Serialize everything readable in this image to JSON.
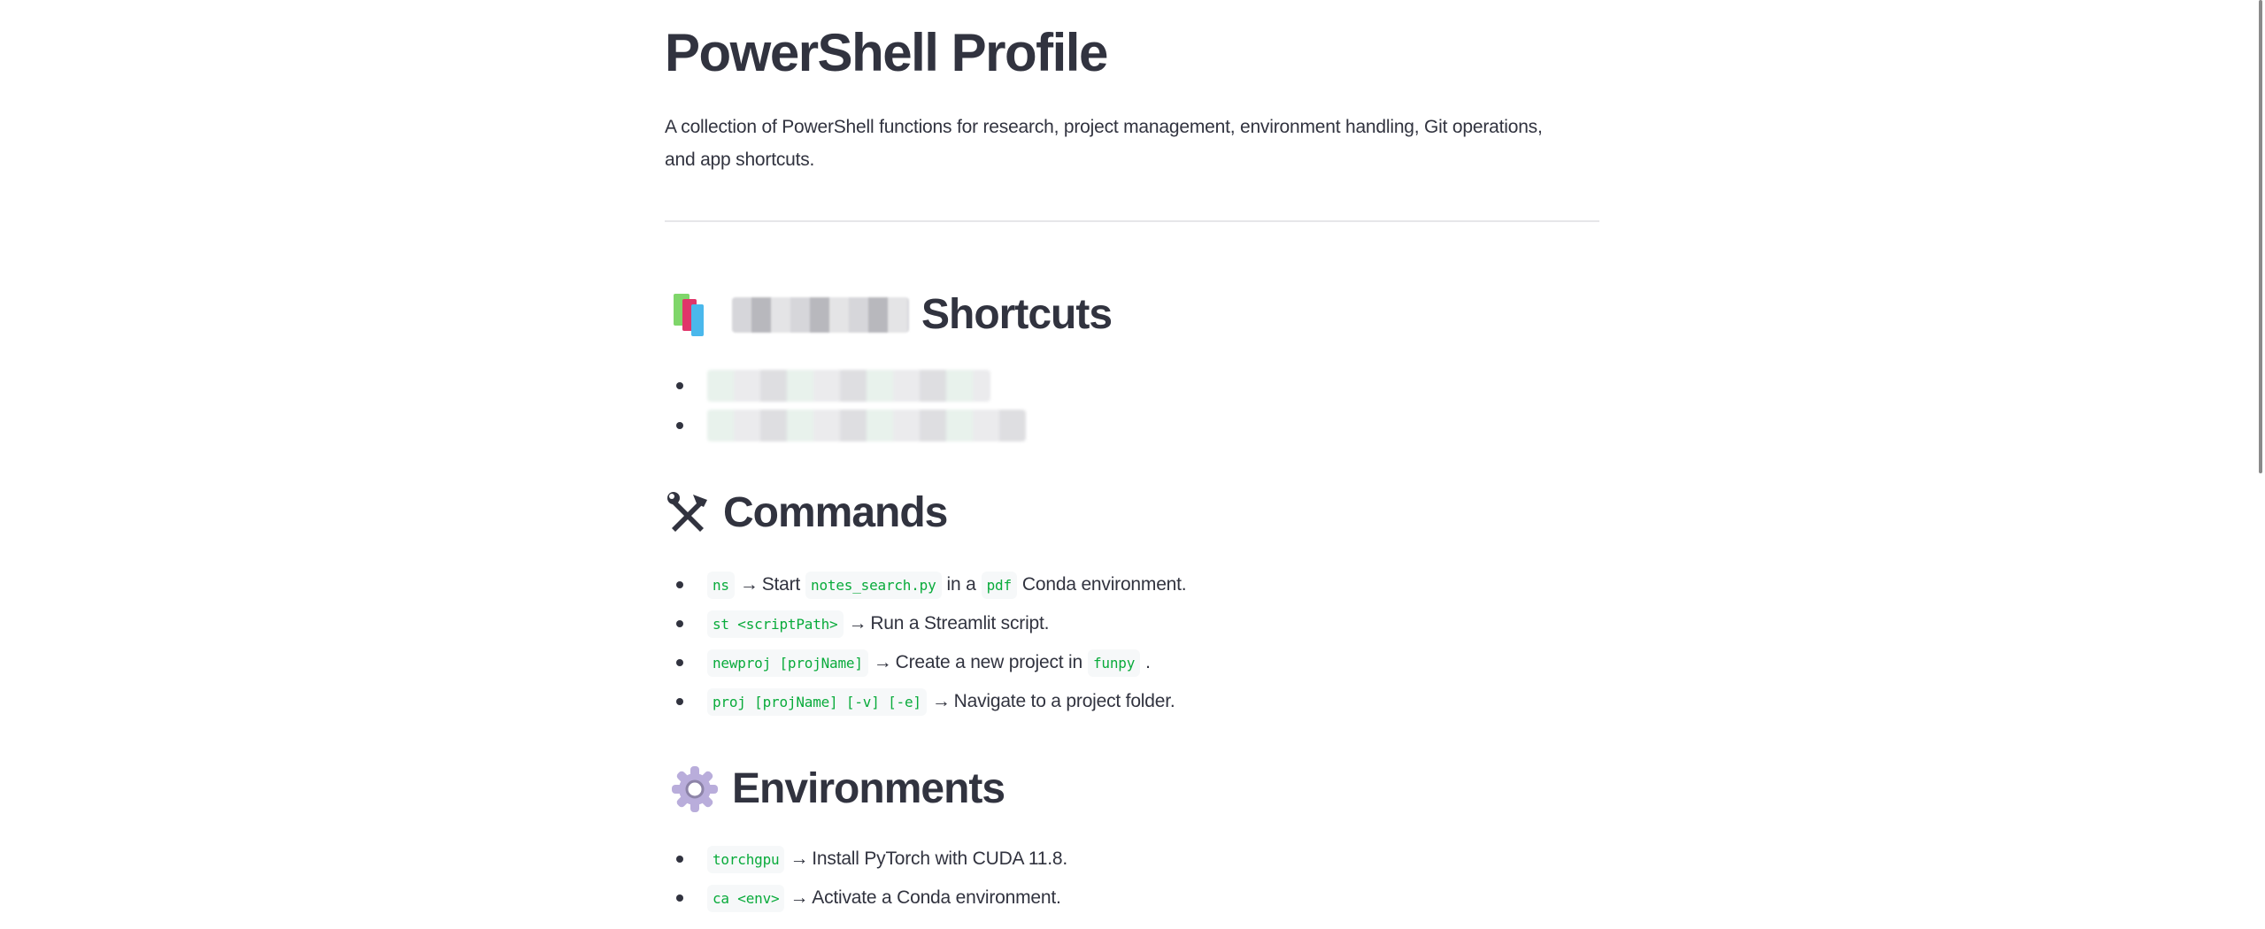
{
  "page": {
    "title": "PowerShell Profile",
    "description": "A collection of PowerShell functions for research, project management, environment handling, Git operations, and app shortcuts."
  },
  "sections": {
    "shortcuts": {
      "icon": "books-icon",
      "heading": "Shortcuts",
      "heading_prefix_redacted": true,
      "items_redacted": 2
    },
    "commands": {
      "icon": "hammer-and-wrench-icon",
      "heading": "Commands",
      "items": [
        {
          "code": "ns",
          "arrow": "→",
          "text1": "Start",
          "code2": "notes_search.py",
          "text2": "in a",
          "code3": "pdf",
          "text3": "Conda environment."
        },
        {
          "code": "st <scriptPath>",
          "arrow": "→",
          "text1": "Run a Streamlit script."
        },
        {
          "code": "newproj [projName]",
          "arrow": "→",
          "text1": "Create a new project in",
          "code2": "funpy",
          "text2": "."
        },
        {
          "code": "proj [projName] [-v] [-e]",
          "arrow": "→",
          "text1": "Navigate to a project folder."
        }
      ]
    },
    "environments": {
      "icon": "gear-icon",
      "heading": "Environments",
      "items": [
        {
          "code": "torchgpu",
          "arrow": "→",
          "text1": "Install PyTorch with CUDA 11.8."
        },
        {
          "code": "ca <env>",
          "arrow": "→",
          "text1": "Activate a Conda environment."
        }
      ]
    }
  },
  "colors": {
    "text": "#31333f",
    "code": "#09ab3b",
    "code_bg": "#f6f8f9",
    "divider": "#e6e6e9"
  }
}
